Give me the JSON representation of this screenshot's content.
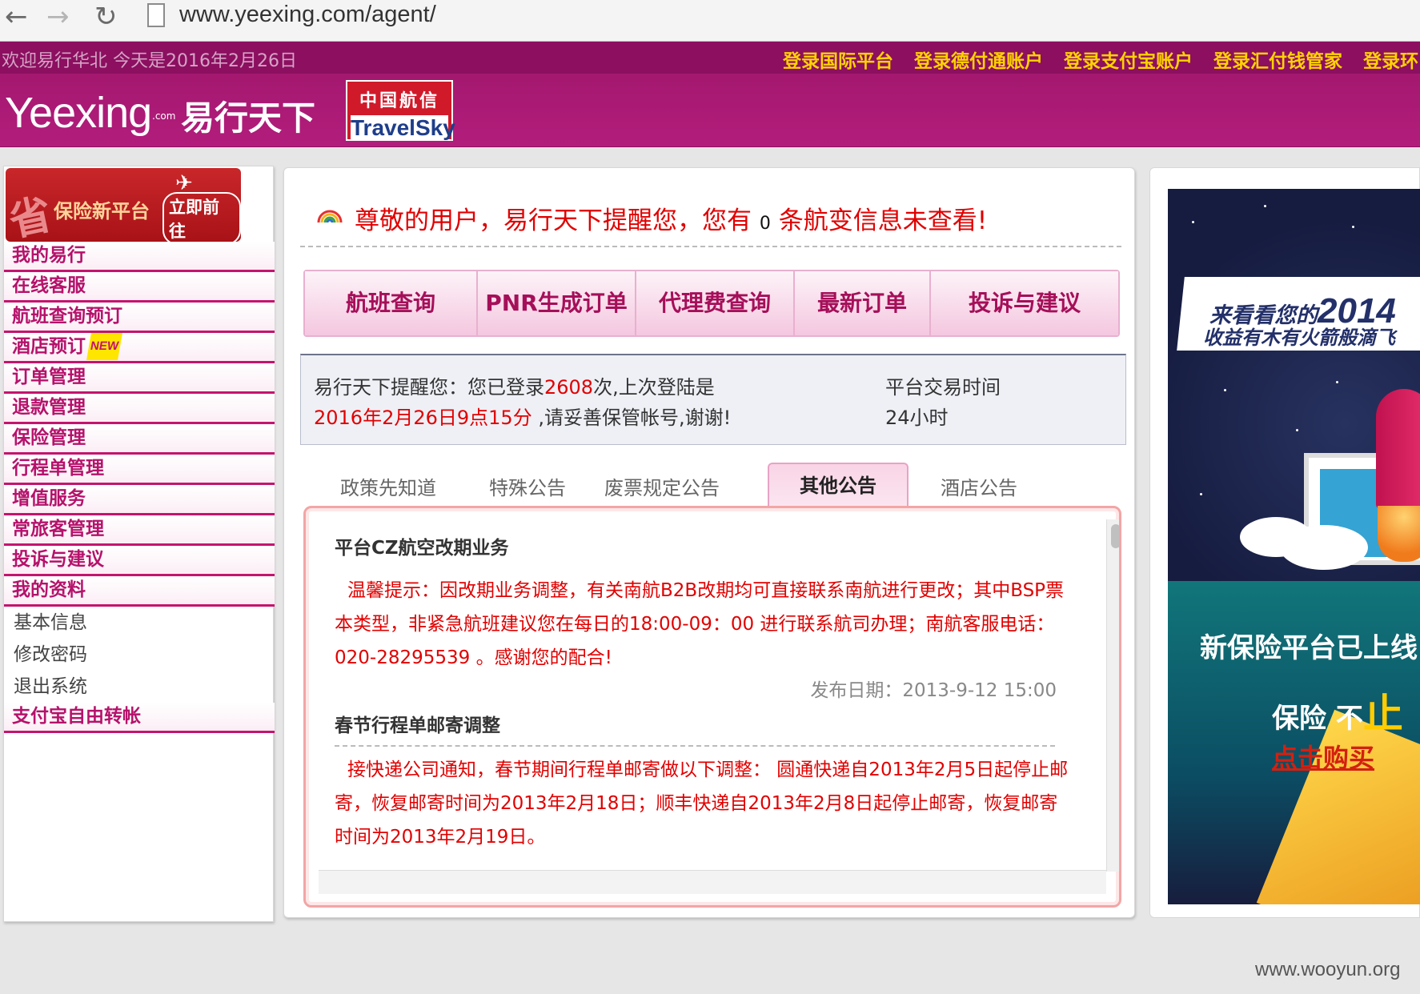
{
  "browser": {
    "url": "www.yeexing.com/agent/"
  },
  "header": {
    "welcome": "欢迎易行华北 今天是2016年2月26日",
    "links": [
      "登录国际平台",
      "登录德付通账户",
      "登录支付宝账户",
      "登录汇付钱管家",
      "登录环"
    ],
    "logo_en": "Yeexing",
    "logo_com": ".com",
    "logo_cn": "易行天下",
    "partner_cn": "中国航信",
    "partner_en": "TravelSky"
  },
  "sidebar": {
    "promo": {
      "char": "省",
      "text": "保险新平台",
      "cta": "立即前往"
    },
    "items": [
      {
        "label": "我的易行"
      },
      {
        "label": "在线客服"
      },
      {
        "label": "航班查询预订"
      },
      {
        "label": "酒店预订",
        "badge": "NEW"
      },
      {
        "label": "订单管理"
      },
      {
        "label": "退款管理"
      },
      {
        "label": "保险管理"
      },
      {
        "label": "行程单管理"
      },
      {
        "label": "增值服务"
      },
      {
        "label": "常旅客管理"
      },
      {
        "label": "投诉与建议"
      },
      {
        "label": "我的资料"
      }
    ],
    "sub_items": [
      "基本信息",
      "修改密码",
      "退出系统"
    ],
    "last_item": "支付宝自由转帐"
  },
  "main": {
    "alert": {
      "prefix": "尊敬的用户，易行天下提醒您，您有",
      "count": "0",
      "suffix": "条航变信息未查看!"
    },
    "tabs": [
      "航班查询",
      "PNR生成订单",
      "代理费查询",
      "最新订单",
      "投诉与建议"
    ],
    "login_info": {
      "line1_prefix": "易行天下提醒您：您已登录",
      "login_count": "2608",
      "line1_suffix": "次,上次登陆是",
      "last_login": "2016年2月26日9点15分",
      "line2_suffix": " ,请妥善保管帐号,谢谢!",
      "trade_label": "平台交易时间",
      "trade_value": "24小时"
    },
    "notice_tabs": [
      "政策先知道",
      "特殊公告",
      "废票规定公告",
      "其他公告",
      "酒店公告"
    ],
    "active_notice_tab": "其他公告",
    "notices": [
      {
        "title": "平台CZ航空改期业务",
        "body": "温馨提示：因改期业务调整，有关南航B2B改期均可直接联系南航进行更改；其中BSP票本类型，非紧急航班建议您在每日的18:00-09：00 进行联系航司办理；南航客服电话：020-28295539 。感谢您的配合!",
        "date": "发布日期：2013-9-12 15:00"
      },
      {
        "title": "春节行程单邮寄调整",
        "body": "接快递公司通知，春节期间行程单邮寄做以下调整： 圆通快递自2013年2月5日起停止邮寄，恢复邮寄时间为2013年2月18日；顺丰快递自2013年2月8日起停止邮寄，恢复邮寄时间为2013年2月19日。",
        "date": ""
      }
    ]
  },
  "right_banner": {
    "top_line1_prefix": "来看看您的",
    "top_year": "2014",
    "top_line2": "收益有木有火箭般滴飞",
    "bottom_line1": "新保险平台已上线",
    "bottom_line2_prefix": "保险 不",
    "bottom_line2_zhi": "止",
    "bottom_line3": "点击购买"
  },
  "watermark": "www.wooyun.org"
}
